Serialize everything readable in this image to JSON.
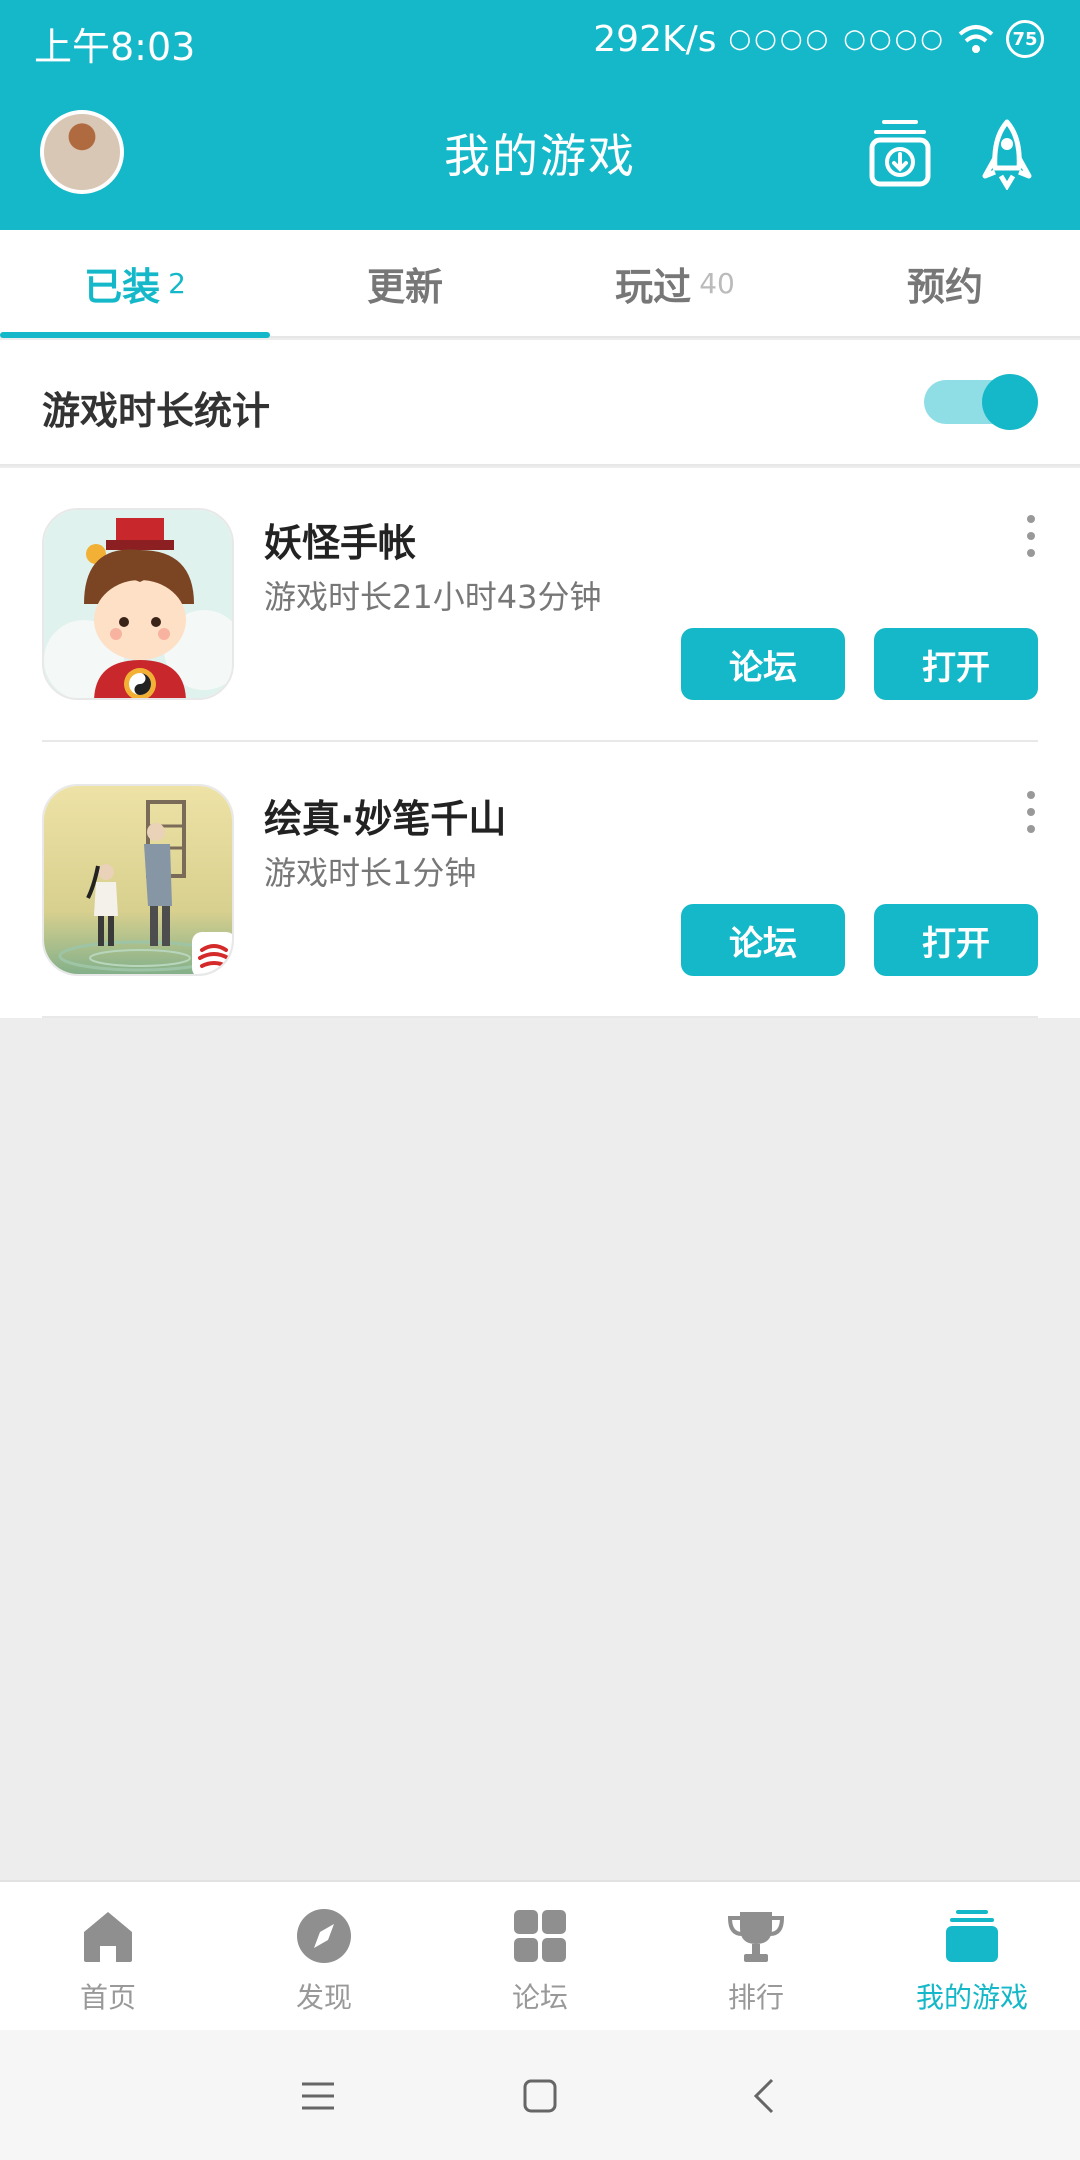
{
  "status_bar": {
    "time": "上午8:03",
    "net_speed": "292K/s",
    "signal1": "○○○○",
    "signal2": "○○○○",
    "battery": "75"
  },
  "header": {
    "title": "我的游戏"
  },
  "tabs": [
    {
      "label": "已装",
      "count": "2"
    },
    {
      "label": "更新",
      "count": ""
    },
    {
      "label": "玩过",
      "count": "40"
    },
    {
      "label": "预约",
      "count": ""
    }
  ],
  "stats": {
    "label": "游戏时长统计",
    "enabled": true
  },
  "games": [
    {
      "name": "妖怪手帐",
      "time": "游戏时长21小时43分钟",
      "forum_label": "论坛",
      "open_label": "打开"
    },
    {
      "name": "绘真·妙笔千山",
      "time": "游戏时长1分钟",
      "forum_label": "论坛",
      "open_label": "打开"
    }
  ],
  "bottom_nav": [
    {
      "label": "首页",
      "icon": "home-icon"
    },
    {
      "label": "发现",
      "icon": "compass-icon"
    },
    {
      "label": "论坛",
      "icon": "grid-icon"
    },
    {
      "label": "排行",
      "icon": "trophy-icon"
    },
    {
      "label": "我的游戏",
      "icon": "stack-icon",
      "active": true
    }
  ],
  "colors": {
    "accent": "#15b8c8",
    "background": "#ededed"
  }
}
